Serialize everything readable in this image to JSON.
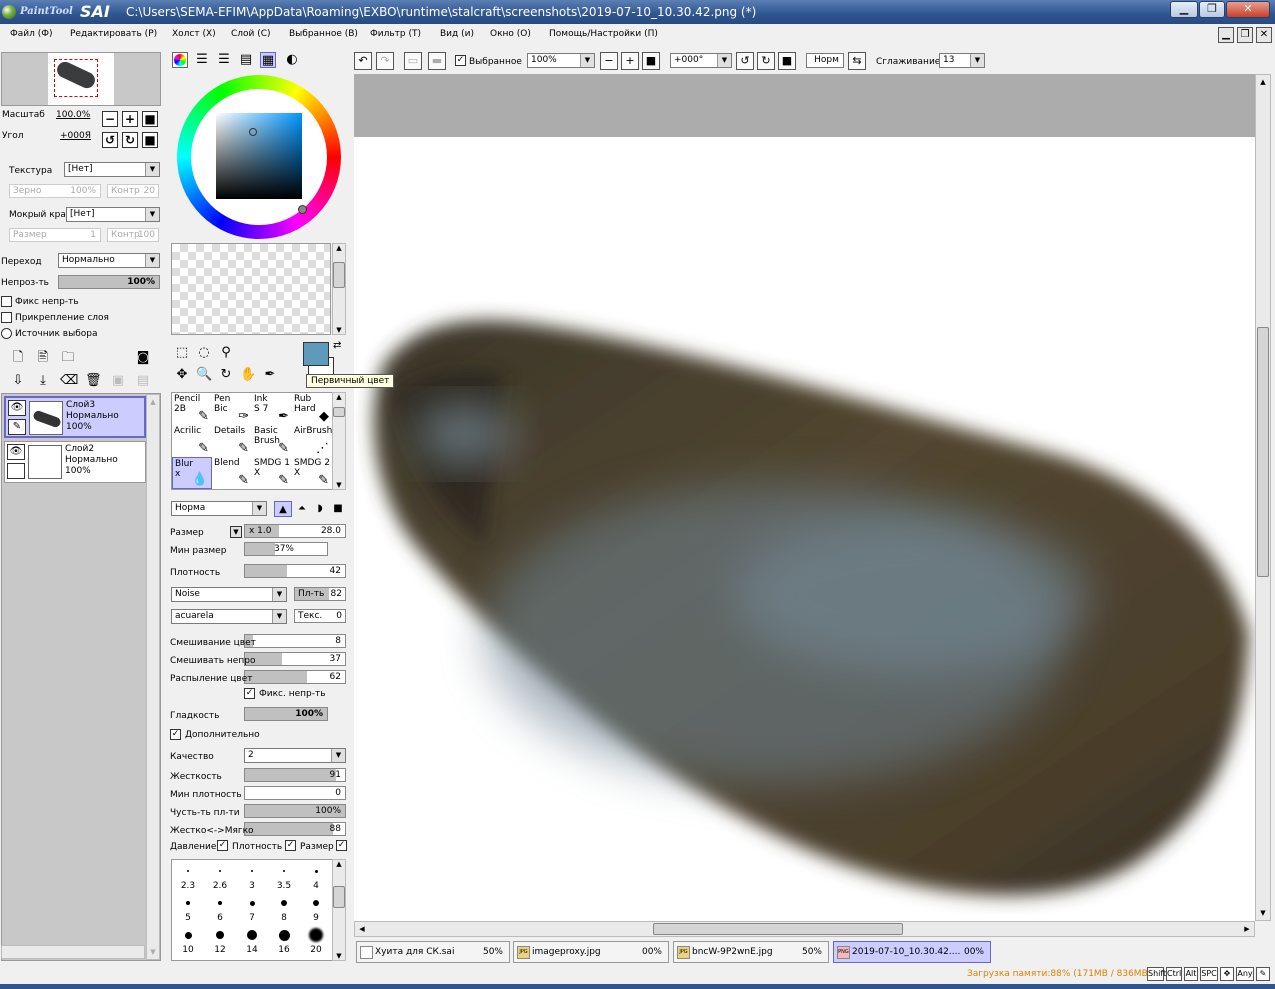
{
  "window": {
    "app_name_small": "PaintTool",
    "app_name_big": "SAI",
    "title": "C:\\Users\\SEMA-EFIM\\AppData\\Roaming\\EXBO\\runtime\\stalcraft\\screenshots\\2019-07-10_10.30.42.png (*)"
  },
  "menu": [
    "Файл (Ф)",
    "Редактировать (Р)",
    "Холст (Х)",
    "Слой (С)",
    "Выбранное (В)",
    "Фильтр (Т)",
    "Вид (и)",
    "Окно (О)",
    "Помощь/Настройки (П)"
  ],
  "navigator": {
    "zoom_label": "Масштаб",
    "zoom_value": "100.0%",
    "angle_label": "Угол",
    "angle_value": "+000Я"
  },
  "paper": {
    "texture_label": "Текстура",
    "texture_value": "[Нет]",
    "grain_label": "Зерно",
    "grain_value": "100%",
    "contrast_label": "Контр",
    "contrast_value": "20",
    "wet_label": "Мокрый край",
    "wet_value": "[Нет]",
    "size_label": "Размер",
    "size_value": "1",
    "contrast2_label": "Контр",
    "contrast2_value": "100"
  },
  "layer_props": {
    "blend_label": "Переход",
    "blend_value": "Нормально",
    "opacity_label": "Непроз-ть",
    "opacity_value": "100%",
    "opacity_fraction": 1.0,
    "fix_opacity": "Фикс непр-ть",
    "clip_layer": "Прикрепление слоя",
    "selection_source": "Источник выбора"
  },
  "layers": [
    {
      "name": "Слой3",
      "mode": "Нормально",
      "opacity": "100%",
      "selected": true
    },
    {
      "name": "Слой2",
      "mode": "Нормально",
      "opacity": "100%",
      "selected": false
    }
  ],
  "color": {
    "primary": "#5e9ab9",
    "tooltip": "Первичный цвет"
  },
  "tools": [
    {
      "name": "Pencil",
      "val": "2B"
    },
    {
      "name": "Pen",
      "val": "Bic"
    },
    {
      "name": "Ink",
      "val": "S 7"
    },
    {
      "name": "Rub",
      "val": "Hard"
    },
    {
      "name": "Acrilic",
      "val": ""
    },
    {
      "name": "Details",
      "val": ""
    },
    {
      "name": "Basic",
      "val": "Brush"
    },
    {
      "name": "AirBrush",
      "val": ""
    },
    {
      "name": "Blur",
      "val": "x"
    },
    {
      "name": "Blend",
      "val": ""
    },
    {
      "name": "SMDG 1",
      "val": "X"
    },
    {
      "name": "SMDG 2",
      "val": "X"
    }
  ],
  "brush": {
    "mode": "Норма",
    "size_label": "Размер",
    "size_mult": "x 1.0",
    "size_value": "28.0",
    "min_size_label": "Мин размер",
    "min_size_value": "37%",
    "min_size_fraction": 0.37,
    "density_label": "Плотность",
    "density_value": "42",
    "density_fraction": 0.42,
    "shape": "Noise",
    "shape_density_label": "Пл-ть",
    "shape_density_value": "82",
    "texture": "acuarela",
    "texture_label": "Текс.",
    "texture_value": "0",
    "blend_color_label": "Смешивание цвет",
    "blend_color_value": "8",
    "blend_color_fraction": 0.08,
    "dilution_label": "Смешивать непро",
    "dilution_value": "37",
    "dilution_fraction": 0.37,
    "persistence_label": "Распыление цвет",
    "persistence_value": "62",
    "persistence_fraction": 0.62,
    "fix_opacity": "Фикс. непр-ть",
    "smooth_label": "Гладкость",
    "smooth_value": "100%",
    "smooth_fraction": 1.0,
    "advanced": "Дополнительно",
    "quality_label": "Качество",
    "quality_value": "2",
    "hardness_label": "Жесткость",
    "hardness_value": "91",
    "hardness_fraction": 0.91,
    "min_density_label": "Мин плотность",
    "min_density_value": "0",
    "min_density_fraction": 0.0,
    "sensitivity_label": "Чусть-ть пл-ти",
    "sensitivity_value": "100%",
    "sensitivity_fraction": 1.0,
    "hardsoft_label": "Жестко<->Мягко",
    "hardsoft_value": "88",
    "hardsoft_fraction": 0.88,
    "pressure_label": "Давление:",
    "pressure_density": "Плотность",
    "pressure_size": "Размер"
  },
  "brush_sizes": [
    "2.3",
    "2.6",
    "3",
    "3.5",
    "4",
    "5",
    "6",
    "7",
    "8",
    "9",
    "10",
    "12",
    "14",
    "16",
    "20"
  ],
  "toolbar": {
    "selection_label": "Выбранное",
    "zoom": "100%",
    "angle": "+000°",
    "mode": "Норм",
    "stabilizer_label": "Сглаживание",
    "stabilizer_value": "13"
  },
  "tabs": [
    {
      "name": "Хуита для СК.sai",
      "pct": "50%",
      "icon": ""
    },
    {
      "name": "imageproxy.jpg",
      "pct": "00%",
      "icon": "JPG"
    },
    {
      "name": "bncW-9P2wnE.jpg",
      "pct": "50%",
      "icon": "JPG"
    },
    {
      "name": "2019-07-10_10.30.42....",
      "pct": "00%",
      "icon": "PNG"
    }
  ],
  "status": {
    "memory": "Загрузка памяти:88% (171MB / 836MB)",
    "keys": [
      "Shift",
      "Ctrl",
      "Alt",
      "SPC",
      "Any"
    ]
  }
}
